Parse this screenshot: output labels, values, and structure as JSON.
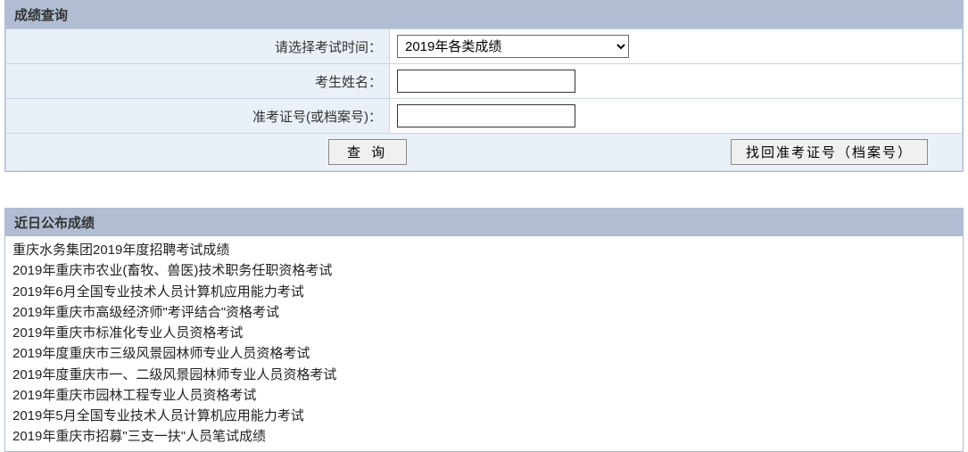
{
  "query_form": {
    "title": "成绩查询",
    "exam_time_label": "请选择考试时间：",
    "exam_time_selected": "2019年各类成绩",
    "name_label": "考生姓名：",
    "name_value": "",
    "ticket_label": "准考证号(或档案号)：",
    "ticket_value": "",
    "query_button": "查 询",
    "retrieve_button": "找回准考证号（档案号）"
  },
  "recent_scores": {
    "title": "近日公布成绩",
    "items": [
      "重庆水务集团2019年度招聘考试成绩",
      "2019年重庆市农业(畜牧、兽医)技术职务任职资格考试",
      "2019年6月全国专业技术人员计算机应用能力考试",
      "2019年重庆市高级经济师\"考评结合\"资格考试",
      "2019年重庆市标准化专业人员资格考试",
      "2019年度重庆市三级风景园林师专业人员资格考试",
      "2019年度重庆市一、二级风景园林师专业人员资格考试",
      "2019年重庆市园林工程专业人员资格考试",
      "2019年5月全国专业技术人员计算机应用能力考试",
      "2019年重庆市招募\"三支一扶\"人员笔试成绩"
    ]
  }
}
